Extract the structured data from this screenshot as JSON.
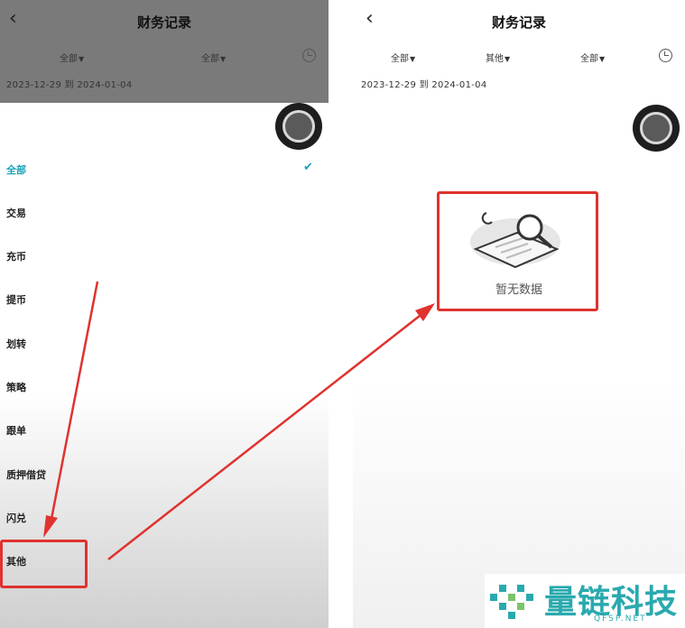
{
  "left": {
    "header": {
      "title": "财务记录",
      "filters": [
        "全部",
        "全部"
      ],
      "date_range": "2023-12-29 到 2024-01-04"
    },
    "options": [
      {
        "label": "全部",
        "selected": true
      },
      {
        "label": "交易"
      },
      {
        "label": "充币"
      },
      {
        "label": "提币"
      },
      {
        "label": "划转"
      },
      {
        "label": "策略"
      },
      {
        "label": "跟单"
      },
      {
        "label": "质押借贷"
      },
      {
        "label": "闪兑"
      },
      {
        "label": "其他"
      }
    ]
  },
  "right": {
    "header": {
      "title": "财务记录",
      "filters": [
        "全部",
        "其他",
        "全部"
      ],
      "date_range": "2023-12-29 到 2024-01-04"
    },
    "empty_state": "暂无数据"
  },
  "colors": {
    "accent": "#1aa3b8",
    "highlight": "#e0322e",
    "watermark": "#2aa9ae"
  },
  "watermark": {
    "brand": "量链科技",
    "url": "QFSP.NET"
  }
}
